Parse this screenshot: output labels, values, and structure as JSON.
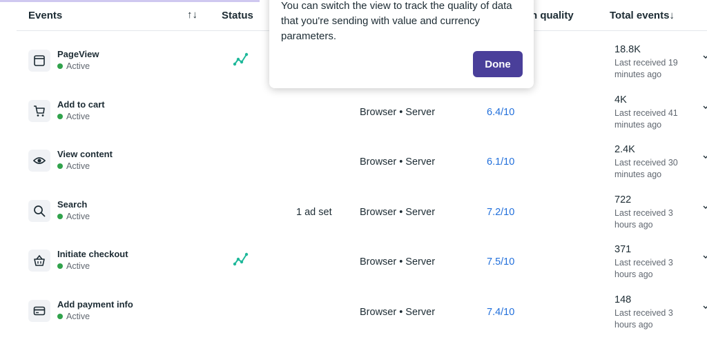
{
  "header": {
    "events_label": "Events",
    "sort_icon": "↑↓",
    "status_label": "Status",
    "match_quality_label": "h quality",
    "total_events_label": "Total events↓"
  },
  "popover": {
    "text": "You can switch the view to track the quality of data that you're sending with value and currency parameters.",
    "done_label": "Done"
  },
  "colors": {
    "accent": "#4a3f9a",
    "active": "#31a24c",
    "link": "#216fdb",
    "spark": "#1fb89a"
  },
  "rows": [
    {
      "icon": "page-icon",
      "name": "PageView",
      "status": "Active",
      "activity": true,
      "ad_sets": "",
      "integration": "",
      "quality": "",
      "total": "18.8K",
      "last": "Last received 19 minutes ago"
    },
    {
      "icon": "cart-icon",
      "name": "Add to cart",
      "status": "Active",
      "activity": false,
      "ad_sets": "",
      "integration": "Browser • Server",
      "quality": "6.4/10",
      "total": "4K",
      "last": "Last received 41 minutes ago"
    },
    {
      "icon": "eye-icon",
      "name": "View content",
      "status": "Active",
      "activity": false,
      "ad_sets": "",
      "integration": "Browser • Server",
      "quality": "6.1/10",
      "total": "2.4K",
      "last": "Last received 30 minutes ago"
    },
    {
      "icon": "search-icon",
      "name": "Search",
      "status": "Active",
      "activity": false,
      "ad_sets": "1 ad set",
      "integration": "Browser • Server",
      "quality": "7.2/10",
      "total": "722",
      "last": "Last received 3 hours ago"
    },
    {
      "icon": "basket-icon",
      "name": "Initiate checkout",
      "status": "Active",
      "activity": true,
      "ad_sets": "",
      "integration": "Browser • Server",
      "quality": "7.5/10",
      "total": "371",
      "last": "Last received 3 hours ago"
    },
    {
      "icon": "card-icon",
      "name": "Add payment info",
      "status": "Active",
      "activity": false,
      "ad_sets": "",
      "integration": "Browser • Server",
      "quality": "7.4/10",
      "total": "148",
      "last": "Last received 3 hours ago"
    }
  ]
}
